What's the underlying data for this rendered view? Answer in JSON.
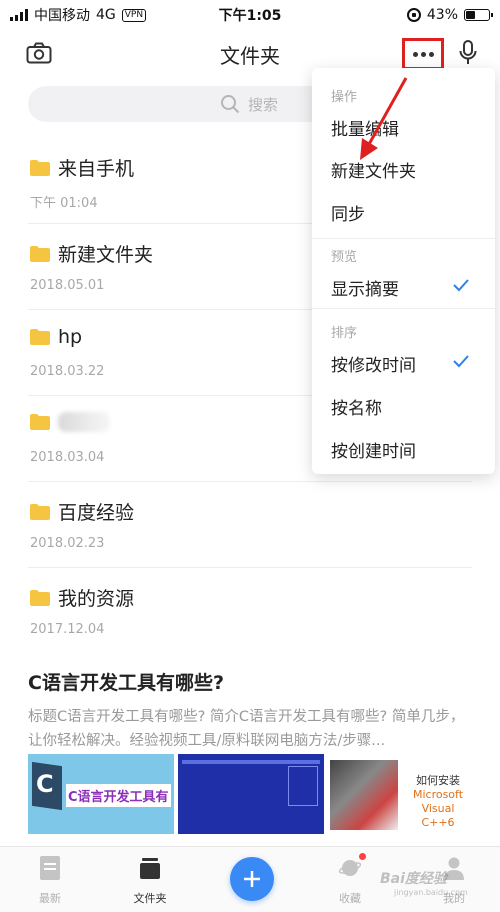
{
  "status_bar": {
    "carrier": "中国移动",
    "network": "4G",
    "vpn": "VPN",
    "time": "下午1:05",
    "battery": "43%",
    "battery_level": 0.43
  },
  "nav": {
    "title": "文件夹"
  },
  "search": {
    "placeholder": "搜索"
  },
  "folders": [
    {
      "name": "来自手机",
      "date": "下午 01:04"
    },
    {
      "name": "新建文件夹",
      "date": "2018.05.01"
    },
    {
      "name": "hp",
      "date": "2018.03.22"
    },
    {
      "name": "",
      "date": "2018.03.04"
    },
    {
      "name": "百度经验",
      "date": "2018.02.23"
    },
    {
      "name": "我的资源",
      "date": "2017.12.04"
    }
  ],
  "article": {
    "title": "C语言开发工具有哪些?",
    "summary": "标题C语言开发工具有哪些? 简介C语言开发工具有哪些? 简单几步，让你轻松解决。经验视频工具/原料联网电脑方法/步骤...",
    "thumb1_text": "C语言开发工具有",
    "thumb1_letter": "C",
    "thumb3_line1": "如何安装",
    "thumb3_line2": "Microsoft",
    "thumb3_line3": "Visual C++6"
  },
  "menu": {
    "section_actions": "操作",
    "batch_edit": "批量编辑",
    "new_folder": "新建文件夹",
    "sync": "同步",
    "section_preview": "预览",
    "show_summary": "显示摘要",
    "section_sort": "排序",
    "sort_modified": "按修改时间",
    "sort_name": "按名称",
    "sort_created": "按创建时间"
  },
  "tabs": {
    "latest": "最新",
    "folders": "文件夹",
    "favorites": "收藏",
    "mine": "我的"
  },
  "watermark": {
    "brand": "Bai度经验",
    "url": "jingyan.baidu.com"
  },
  "colors": {
    "accent": "#3a8af5",
    "highlight_red": "#e02020",
    "folder": "#f5c542",
    "check": "#2f80ed"
  }
}
